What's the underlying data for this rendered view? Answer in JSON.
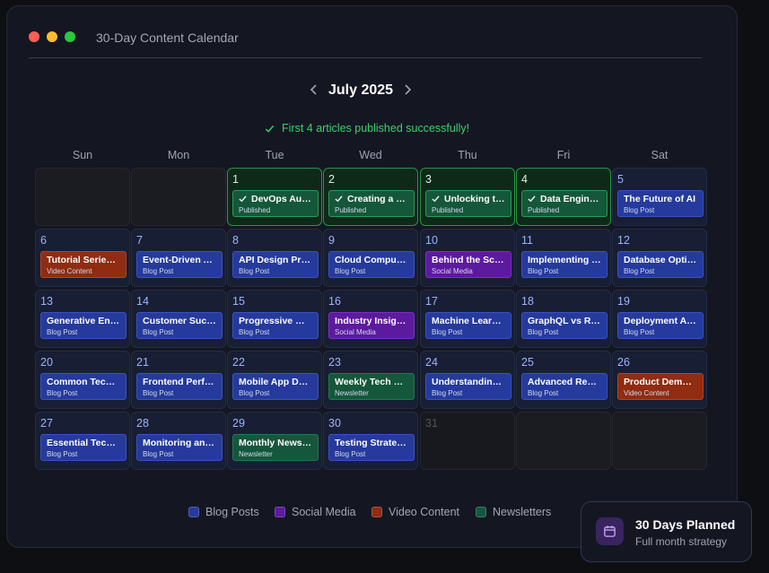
{
  "window": {
    "title": "30-Day Content Calendar"
  },
  "calendar": {
    "month_label": "July 2025",
    "status": "First 4 articles published successfully!",
    "weekdays": [
      "Sun",
      "Mon",
      "Tue",
      "Wed",
      "Thu",
      "Fri",
      "Sat"
    ],
    "weeks": [
      [
        {
          "day": "",
          "state": "empty"
        },
        {
          "day": "",
          "state": "empty"
        },
        {
          "day": "1",
          "state": "published",
          "event": {
            "title": "DevOps Automation",
            "type": "Published",
            "kind": "published"
          }
        },
        {
          "day": "2",
          "state": "published",
          "event": {
            "title": "Creating a Remote",
            "type": "Published",
            "kind": "published"
          }
        },
        {
          "day": "3",
          "state": "published",
          "event": {
            "title": "Unlocking the Power",
            "type": "Published",
            "kind": "published"
          }
        },
        {
          "day": "4",
          "state": "published",
          "event": {
            "title": "Data Engineering",
            "type": "Published",
            "kind": "published"
          }
        },
        {
          "day": "5",
          "state": "normal",
          "event": {
            "title": "The Future of AI",
            "type": "Blog Post",
            "kind": "blog"
          }
        }
      ],
      [
        {
          "day": "6",
          "state": "normal",
          "event": {
            "title": "Tutorial Series Launch",
            "type": "Video Content",
            "kind": "video"
          }
        },
        {
          "day": "7",
          "state": "normal",
          "event": {
            "title": "Event-Driven Architecture",
            "type": "Blog Post",
            "kind": "blog"
          }
        },
        {
          "day": "8",
          "state": "normal",
          "event": {
            "title": "API Design Principles",
            "type": "Blog Post",
            "kind": "blog"
          }
        },
        {
          "day": "9",
          "state": "normal",
          "event": {
            "title": "Cloud Computing Trends",
            "type": "Blog Post",
            "kind": "blog"
          }
        },
        {
          "day": "10",
          "state": "normal",
          "event": {
            "title": "Behind the Scenes",
            "type": "Social Media",
            "kind": "social"
          }
        },
        {
          "day": "11",
          "state": "normal",
          "event": {
            "title": "Implementing CI/CD",
            "type": "Blog Post",
            "kind": "blog"
          }
        },
        {
          "day": "12",
          "state": "normal",
          "event": {
            "title": "Database Optimization",
            "type": "Blog Post",
            "kind": "blog"
          }
        }
      ],
      [
        {
          "day": "13",
          "state": "normal",
          "event": {
            "title": "Generative Engines",
            "type": "Blog Post",
            "kind": "blog"
          }
        },
        {
          "day": "14",
          "state": "normal",
          "event": {
            "title": "Customer Success Stories",
            "type": "Blog Post",
            "kind": "blog"
          }
        },
        {
          "day": "15",
          "state": "normal",
          "event": {
            "title": "Progressive Web Apps",
            "type": "Blog Post",
            "kind": "blog"
          }
        },
        {
          "day": "16",
          "state": "normal",
          "event": {
            "title": "Industry Insights",
            "type": "Social Media",
            "kind": "social"
          }
        },
        {
          "day": "17",
          "state": "normal",
          "event": {
            "title": "Machine Learning Basics",
            "type": "Blog Post",
            "kind": "blog"
          }
        },
        {
          "day": "18",
          "state": "normal",
          "event": {
            "title": "GraphQL vs REST",
            "type": "Blog Post",
            "kind": "blog"
          }
        },
        {
          "day": "19",
          "state": "normal",
          "event": {
            "title": "Deployment Automation",
            "type": "Blog Post",
            "kind": "blog"
          }
        }
      ],
      [
        {
          "day": "20",
          "state": "normal",
          "event": {
            "title": "Common Tech Pitfalls",
            "type": "Blog Post",
            "kind": "blog"
          }
        },
        {
          "day": "21",
          "state": "normal",
          "event": {
            "title": "Frontend Performance",
            "type": "Blog Post",
            "kind": "blog"
          }
        },
        {
          "day": "22",
          "state": "normal",
          "event": {
            "title": "Mobile App Development",
            "type": "Blog Post",
            "kind": "blog"
          }
        },
        {
          "day": "23",
          "state": "normal",
          "event": {
            "title": "Weekly Tech Roundup",
            "type": "Newsletter",
            "kind": "news"
          }
        },
        {
          "day": "24",
          "state": "normal",
          "event": {
            "title": "Understanding Kubernetes",
            "type": "Blog Post",
            "kind": "blog"
          }
        },
        {
          "day": "25",
          "state": "normal",
          "event": {
            "title": "Advanced React Patterns",
            "type": "Blog Post",
            "kind": "blog"
          }
        },
        {
          "day": "26",
          "state": "normal",
          "event": {
            "title": "Product Demo Video",
            "type": "Video Content",
            "kind": "video"
          }
        }
      ],
      [
        {
          "day": "27",
          "state": "normal",
          "event": {
            "title": "Essential Tech Tools",
            "type": "Blog Post",
            "kind": "blog"
          }
        },
        {
          "day": "28",
          "state": "normal",
          "event": {
            "title": "Monitoring and Logging",
            "type": "Blog Post",
            "kind": "blog"
          }
        },
        {
          "day": "29",
          "state": "normal",
          "event": {
            "title": "Monthly Newsletter",
            "type": "Newsletter",
            "kind": "news"
          }
        },
        {
          "day": "30",
          "state": "normal",
          "event": {
            "title": "Testing Strategies",
            "type": "Blog Post",
            "kind": "blog"
          }
        },
        {
          "day": "31",
          "state": "faded"
        },
        {
          "day": "",
          "state": "empty"
        },
        {
          "day": "",
          "state": "empty"
        }
      ]
    ]
  },
  "legend": [
    {
      "label": "Blog Posts",
      "color": "#253a9c"
    },
    {
      "label": "Social Media",
      "color": "#5c1a9e"
    },
    {
      "label": "Video Content",
      "color": "#8f2c12"
    },
    {
      "label": "Newsletters",
      "color": "#14573a"
    }
  ],
  "toast": {
    "title": "30 Days Planned",
    "subtitle": "Full month strategy",
    "icon": "calendar-icon"
  },
  "colors": {
    "published_accent": "#3fcf6b",
    "day_number": "#9cb4ff"
  }
}
